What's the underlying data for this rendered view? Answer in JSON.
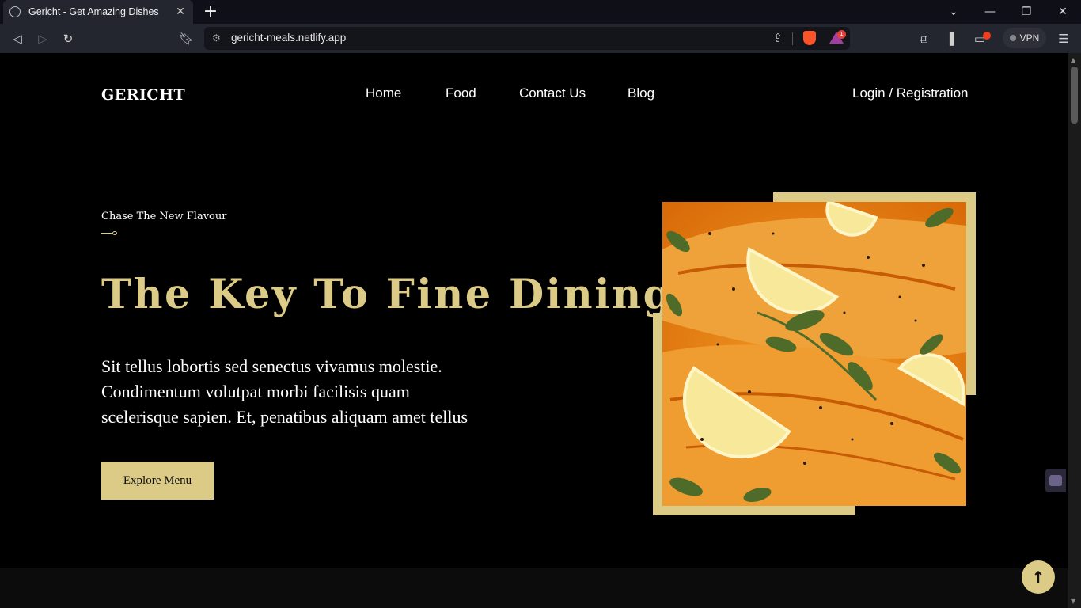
{
  "browser": {
    "tab_title": "Gericht - Get Amazing Dishes",
    "url": "gericht-meals.netlify.app",
    "vpn_label": "VPN",
    "rewards_count": "1"
  },
  "site": {
    "logo": "GERICHT",
    "nav": [
      "Home",
      "Food",
      "Contact Us",
      "Blog"
    ],
    "auth_link": "Login / Registration"
  },
  "hero": {
    "subtitle": "Chase The New Flavour",
    "headline": "The Key To Fine Dining",
    "paragraph": "Sit tellus lobortis sed senectus vivamus molestie. Condimentum volutpat morbi facilisis quam scelerisque sapien. Et, penatibus aliquam amet tellus",
    "cta": "Explore Menu"
  },
  "colors": {
    "accent": "#dcca87",
    "background": "#000000",
    "text": "#ffffff"
  }
}
